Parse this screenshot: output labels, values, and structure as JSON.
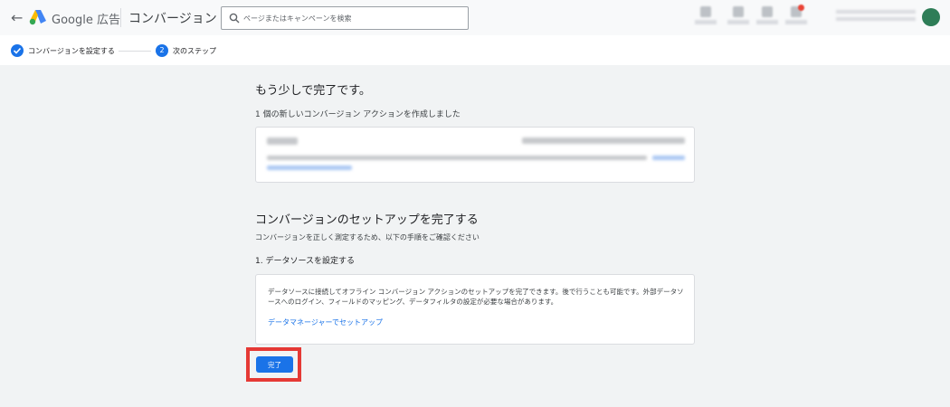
{
  "header": {
    "brand": "Google 広告",
    "page_title": "コンバージョン",
    "search_placeholder": "ページまたはキャンペーンを検索"
  },
  "stepper": {
    "step1_label": "コンバージョンを設定する",
    "step2_number": "2",
    "step2_label": "次のステップ"
  },
  "main": {
    "heading": "もう少しで完了です。",
    "created_text": "1 個の新しいコンバージョン アクションを作成しました",
    "setup_heading": "コンバージョンのセットアップを完了する",
    "setup_sub": "コンバージョンを正しく測定するため、以下の手順をご確認ください",
    "step_heading": "1. データソースを設定する",
    "datasource_desc": "データソースに接続してオフライン コンバージョン アクションのセットアップを完了できます。後で行うことも可能です。外部データソースへのログイン、フィールドのマッピング、データフィルタの設定が必要な場合があります。",
    "datasource_link": "データマネージャーでセットアップ",
    "done_button": "完了"
  },
  "colors": {
    "accent": "#1a73e8",
    "highlight": "#e53935",
    "avatar": "#2e7d57"
  }
}
